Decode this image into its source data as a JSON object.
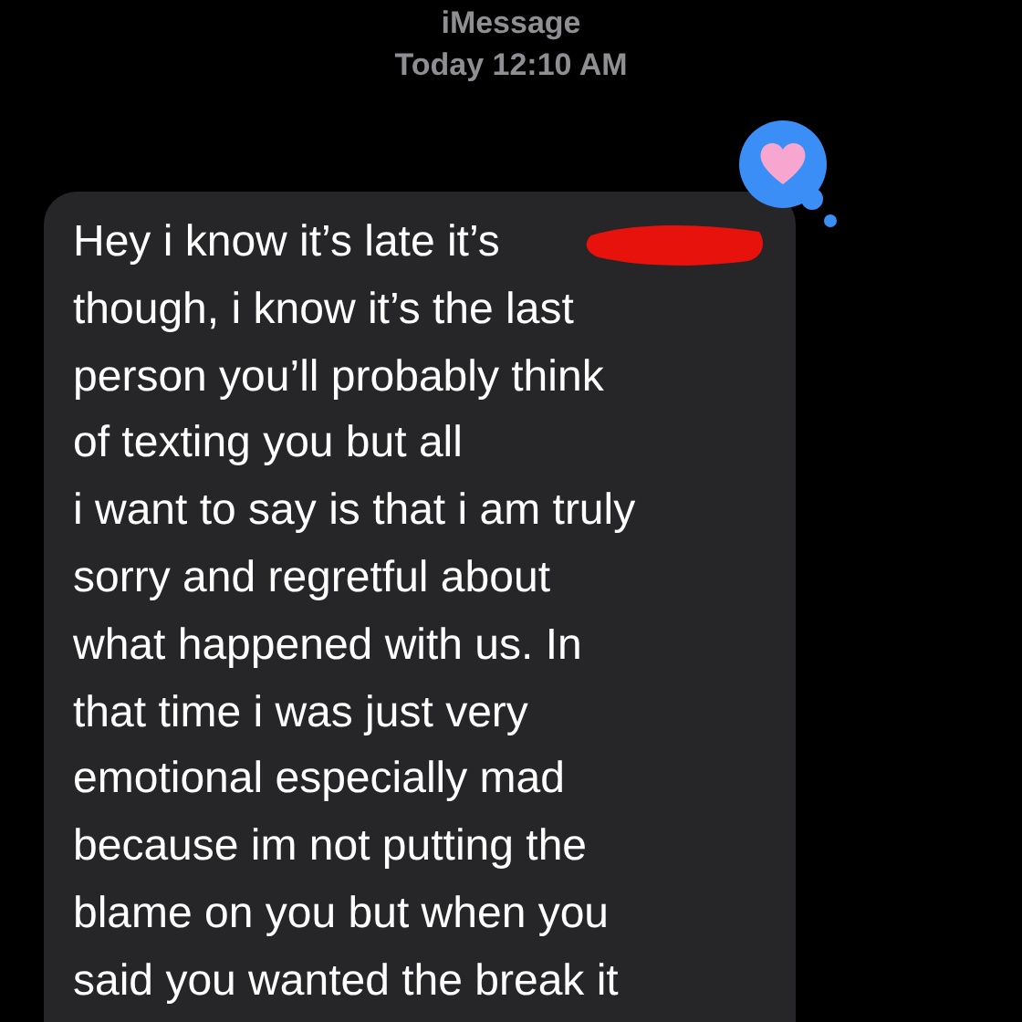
{
  "header": {
    "service": "iMessage",
    "timestamp": "Today 12:10 AM"
  },
  "message": {
    "text": "Hey i know it’s late it’s\nthough, i know it’s the last\nperson you’ll probably think\nof texting you but all\ni want to say is that i am truly\nsorry and regretful about\nwhat happened with us. In\nthat time i was just very\nemotional especially mad\nbecause im not putting the\nblame on you but when you\nsaid you wanted the break it",
    "redacted": true
  }
}
